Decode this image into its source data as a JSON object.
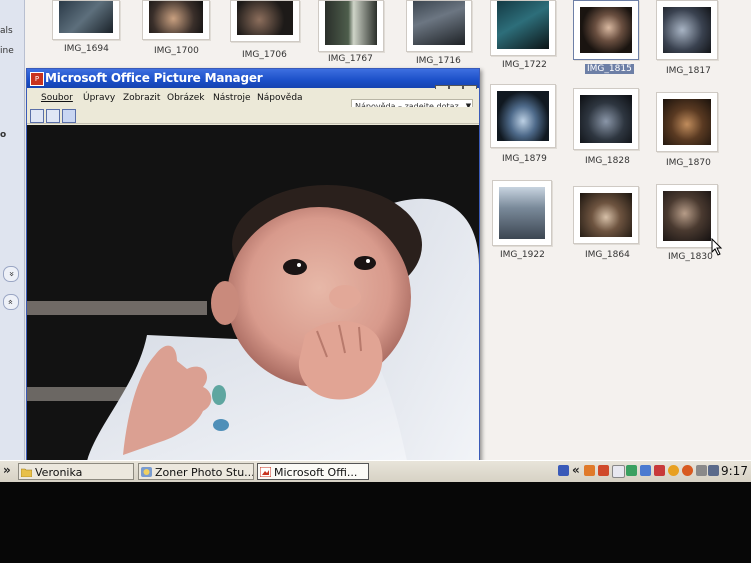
{
  "sidebar": {
    "fragments": [
      "als",
      "ine",
      "o"
    ],
    "chevrons": [
      "»",
      "»"
    ]
  },
  "thumbnails": [
    {
      "label": "IMG_1694",
      "selected": false
    },
    {
      "label": "IMG_1700",
      "selected": false
    },
    {
      "label": "IMG_1706",
      "selected": false
    },
    {
      "label": "IMG_1767",
      "selected": false
    },
    {
      "label": "IMG_1716",
      "selected": false
    },
    {
      "label": "IMG_1722",
      "selected": false
    },
    {
      "label": "IMG_1815",
      "selected": true
    },
    {
      "label": "IMG_1817",
      "selected": false
    },
    {
      "label": "IMG_1879",
      "selected": false
    },
    {
      "label": "IMG_1828",
      "selected": false
    },
    {
      "label": "IMG_1870",
      "selected": false
    },
    {
      "label": "IMG_1922",
      "selected": false
    },
    {
      "label": "IMG_1864",
      "selected": false
    },
    {
      "label": "IMG_1830",
      "selected": false
    }
  ],
  "picture_manager": {
    "title": "Microsoft Office Picture Manager",
    "menu": [
      "Soubor",
      "Úpravy",
      "Zobrazit",
      "Obrázek",
      "Nástroje",
      "Nápověda"
    ],
    "help_box": "Nápověda – zadejte dotaz",
    "title_buttons": [
      "_",
      "□",
      "×"
    ]
  },
  "taskbar": {
    "start_arrow": "»",
    "tasks": [
      {
        "label": "Veronika",
        "icon": "folder-icon",
        "active": false
      },
      {
        "label": "Zoner Photo Stu...",
        "icon": "zoner-icon",
        "active": false
      },
      {
        "label": "Microsoft Offi...",
        "icon": "picture-manager-icon",
        "active": true
      }
    ],
    "tray_toggle": "«",
    "clock": "9:17",
    "colors": {
      "accent": "#1b4fc8",
      "selection": "#6d7fa6"
    }
  }
}
